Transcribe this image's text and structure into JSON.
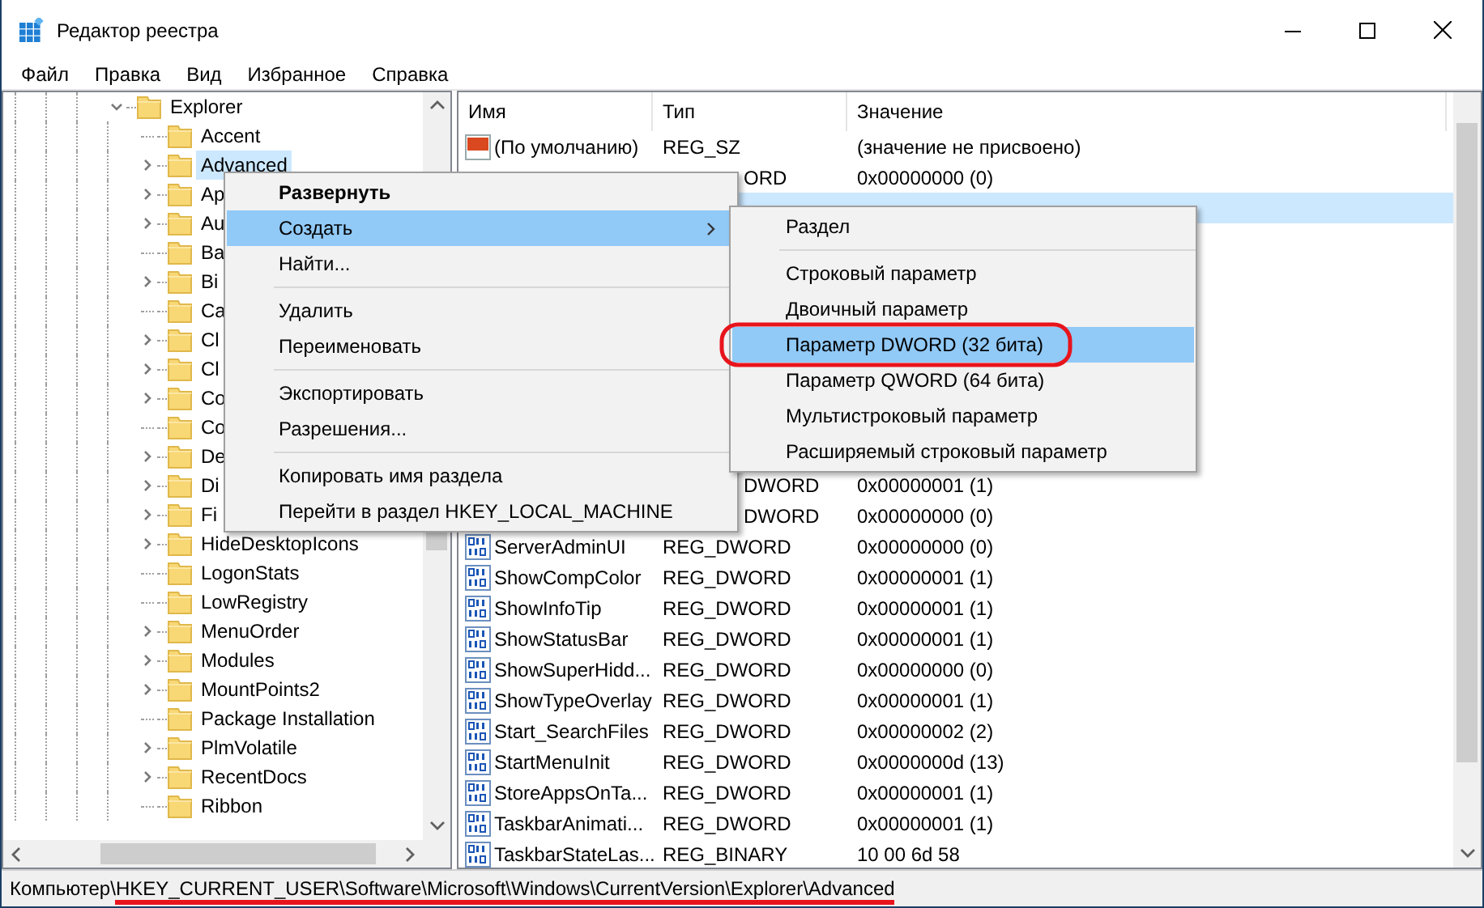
{
  "window": {
    "title": "Редактор реестра"
  },
  "menu_bar": [
    "Файл",
    "Правка",
    "Вид",
    "Избранное",
    "Справка"
  ],
  "tree": [
    {
      "label": "Explorer",
      "expandable": true,
      "expanded": true,
      "selected": false,
      "children": [
        {
          "label": "Accent",
          "expandable": false,
          "selected": false
        },
        {
          "label": "Advanced",
          "expandable": true,
          "selected": true
        },
        {
          "label": "Ap",
          "expandable": true,
          "selected": false
        },
        {
          "label": "Au",
          "expandable": true,
          "selected": false
        },
        {
          "label": "Ba",
          "expandable": false,
          "selected": false
        },
        {
          "label": "Bi",
          "expandable": true,
          "selected": false
        },
        {
          "label": "Ca",
          "expandable": false,
          "selected": false
        },
        {
          "label": "Cl",
          "expandable": true,
          "selected": false
        },
        {
          "label": "Cl",
          "expandable": true,
          "selected": false
        },
        {
          "label": "Co",
          "expandable": true,
          "selected": false
        },
        {
          "label": "Co",
          "expandable": false,
          "selected": false
        },
        {
          "label": "De",
          "expandable": true,
          "selected": false
        },
        {
          "label": "Di",
          "expandable": true,
          "selected": false
        },
        {
          "label": "Fi",
          "expandable": true,
          "selected": false
        },
        {
          "label": "HideDesktopIcons",
          "expandable": true,
          "selected": false
        },
        {
          "label": "LogonStats",
          "expandable": false,
          "selected": false
        },
        {
          "label": "LowRegistry",
          "expandable": false,
          "selected": false
        },
        {
          "label": "MenuOrder",
          "expandable": true,
          "selected": false
        },
        {
          "label": "Modules",
          "expandable": true,
          "selected": false
        },
        {
          "label": "MountPoints2",
          "expandable": true,
          "selected": false
        },
        {
          "label": "Package Installation",
          "expandable": false,
          "selected": false
        },
        {
          "label": "PlmVolatile",
          "expandable": true,
          "selected": false
        },
        {
          "label": "RecentDocs",
          "expandable": true,
          "selected": false
        },
        {
          "label": "Ribbon",
          "expandable": false,
          "selected": false
        }
      ]
    }
  ],
  "table": {
    "columns": [
      "Имя",
      "Тип",
      "Значение"
    ],
    "rows": [
      {
        "kind": "string",
        "name": "(По умолчанию)",
        "type": "REG_SZ",
        "value": "(значение не присвоено)",
        "selected": false
      },
      {
        "kind": "covered",
        "type": "ORD",
        "value": "0x00000000 (0)",
        "selected": false
      },
      {
        "kind": "hidden",
        "selected": true
      },
      {
        "kind": "hidden",
        "selected": false
      },
      {
        "kind": "hidden",
        "selected": false
      },
      {
        "kind": "hidden",
        "selected": false
      },
      {
        "kind": "hidden",
        "selected": false
      },
      {
        "kind": "hidden",
        "selected": false
      },
      {
        "kind": "hidden",
        "selected": false
      },
      {
        "kind": "hidden",
        "selected": false
      },
      {
        "kind": "hidden",
        "selected": false
      },
      {
        "kind": "covered",
        "type": "DWORD",
        "value": "0x00000001 (1)",
        "selected": false
      },
      {
        "kind": "covered",
        "type": "DWORD",
        "value": "0x00000000 (0)",
        "selected": false
      },
      {
        "kind": "binary",
        "name": "ServerAdminUI",
        "type": "REG_DWORD",
        "value": "0x00000000 (0)",
        "selected": false
      },
      {
        "kind": "binary",
        "name": "ShowCompColor",
        "type": "REG_DWORD",
        "value": "0x00000001 (1)",
        "selected": false
      },
      {
        "kind": "binary",
        "name": "ShowInfoTip",
        "type": "REG_DWORD",
        "value": "0x00000001 (1)",
        "selected": false
      },
      {
        "kind": "binary",
        "name": "ShowStatusBar",
        "type": "REG_DWORD",
        "value": "0x00000001 (1)",
        "selected": false
      },
      {
        "kind": "binary",
        "name": "ShowSuperHidd...",
        "type": "REG_DWORD",
        "value": "0x00000000 (0)",
        "selected": false
      },
      {
        "kind": "binary",
        "name": "ShowTypeOverlay",
        "type": "REG_DWORD",
        "value": "0x00000001 (1)",
        "selected": false
      },
      {
        "kind": "binary",
        "name": "Start_SearchFiles",
        "type": "REG_DWORD",
        "value": "0x00000002 (2)",
        "selected": false
      },
      {
        "kind": "binary",
        "name": "StartMenuInit",
        "type": "REG_DWORD",
        "value": "0x0000000d (13)",
        "selected": false
      },
      {
        "kind": "binary",
        "name": "StoreAppsOnTa...",
        "type": "REG_DWORD",
        "value": "0x00000001 (1)",
        "selected": false
      },
      {
        "kind": "binary",
        "name": "TaskbarAnimati...",
        "type": "REG_DWORD",
        "value": "0x00000001 (1)",
        "selected": false
      },
      {
        "kind": "binary",
        "name": "TaskbarStateLas...",
        "type": "REG_BINARY",
        "value": "10 00 6d 58",
        "selected": false
      }
    ]
  },
  "context_menu": [
    {
      "kind": "item",
      "label": "Развернуть",
      "bold": true,
      "selected": false
    },
    {
      "kind": "item",
      "label": "Создать",
      "submenu": true,
      "selected": true
    },
    {
      "kind": "item",
      "label": "Найти...",
      "selected": false
    },
    {
      "kind": "separator"
    },
    {
      "kind": "item",
      "label": "Удалить",
      "selected": false
    },
    {
      "kind": "item",
      "label": "Переименовать",
      "selected": false
    },
    {
      "kind": "separator"
    },
    {
      "kind": "item",
      "label": "Экспортировать",
      "selected": false
    },
    {
      "kind": "item",
      "label": "Разрешения...",
      "selected": false
    },
    {
      "kind": "separator"
    },
    {
      "kind": "item",
      "label": "Копировать имя раздела",
      "selected": false
    },
    {
      "kind": "item",
      "label": "Перейти в раздел HKEY_LOCAL_MACHINE",
      "selected": false
    }
  ],
  "submenu": [
    {
      "kind": "item",
      "label": "Раздел",
      "selected": false,
      "circled": false
    },
    {
      "kind": "separator"
    },
    {
      "kind": "item",
      "label": "Строковый параметр",
      "selected": false,
      "circled": false
    },
    {
      "kind": "item",
      "label": "Двоичный параметр",
      "selected": false,
      "circled": false
    },
    {
      "kind": "item",
      "label": "Параметр DWORD (32 бита)",
      "selected": true,
      "circled": true
    },
    {
      "kind": "item",
      "label": "Параметр QWORD (64 бита)",
      "selected": false,
      "circled": false
    },
    {
      "kind": "item",
      "label": "Мультистроковый параметр",
      "selected": false,
      "circled": false
    },
    {
      "kind": "item",
      "label": "Расширяемый строковый параметр",
      "selected": false,
      "circled": false
    }
  ],
  "status_bar": {
    "root": "Компьютер\\",
    "path": "HKEY_CURRENT_USER\\Software\\Microsoft\\Windows\\CurrentVersion\\Explorer\\Advanced",
    "path_underlined": true
  }
}
